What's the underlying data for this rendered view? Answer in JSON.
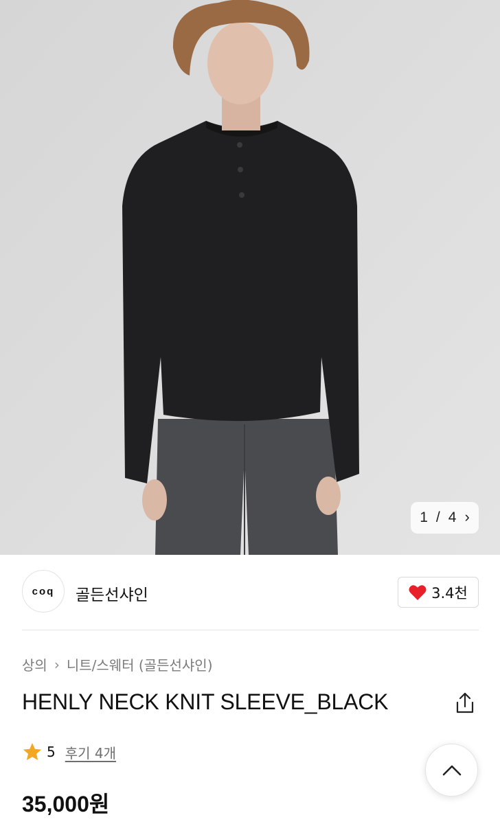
{
  "product_image": {
    "pager": {
      "current": "1",
      "separator": "/",
      "total": "4",
      "next_icon": "chevron-right-icon"
    }
  },
  "shop": {
    "logo_text": "coq",
    "name": "골든선샤인",
    "like_count": "3.4천",
    "like_icon": "heart-icon",
    "like_color": "#e8202a"
  },
  "breadcrumb": {
    "category": "상의",
    "separator_icon": "chevron-right-icon",
    "subcategory": "니트/스웨터 (골든선샤인)"
  },
  "product": {
    "title": "HENLY NECK KNIT SLEEVE_BLACK",
    "share_icon": "share-icon",
    "rating": "5",
    "rating_icon": "star-icon",
    "rating_color": "#f5a623",
    "review_link": "후기 4개",
    "price": "35,000원"
  },
  "scroll_top": {
    "icon": "chevron-up-icon"
  }
}
